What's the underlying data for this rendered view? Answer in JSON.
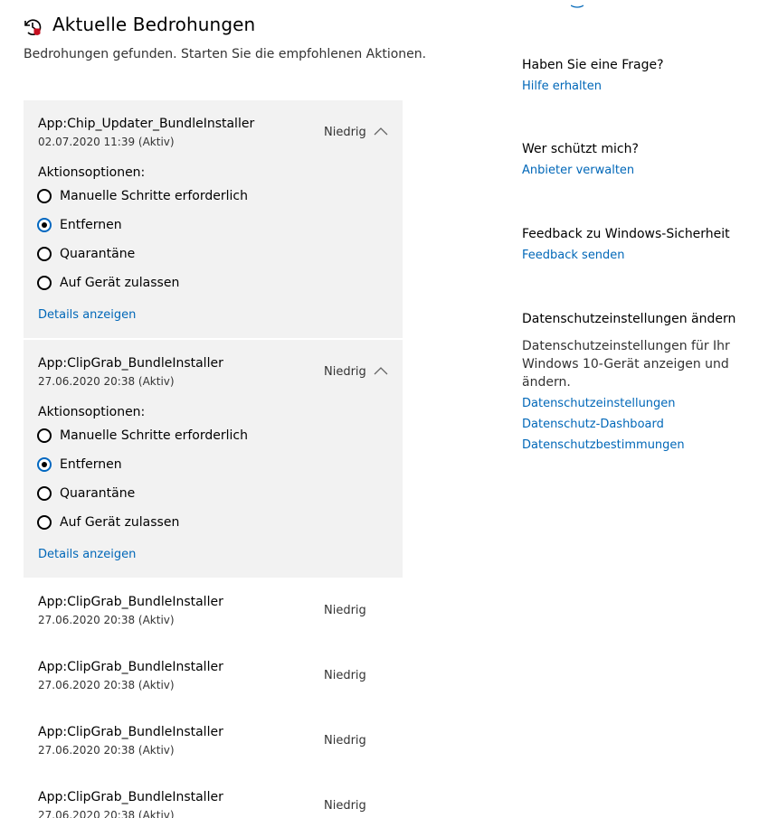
{
  "header": {
    "title": "Aktuelle Bedrohungen",
    "subtitle": "Bedrohungen gefunden. Starten Sie die empfohlenen Aktionen.",
    "icon": "history-shield-icon"
  },
  "threats": [
    {
      "name": "App:Chip_Updater_BundleInstaller",
      "date": "02.07.2020 11:39 (Aktiv)",
      "severity": "Niedrig",
      "expanded": true,
      "options_label": "Aktionsoptionen:",
      "options": [
        "Manuelle Schritte erforderlich",
        "Entfernen",
        "Quarantäne",
        "Auf Gerät zulassen"
      ],
      "selected": "Entfernen",
      "details_link": "Details anzeigen"
    },
    {
      "name": "App:ClipGrab_BundleInstaller",
      "date": "27.06.2020 20:38 (Aktiv)",
      "severity": "Niedrig",
      "expanded": true,
      "options_label": "Aktionsoptionen:",
      "options": [
        "Manuelle Schritte erforderlich",
        "Entfernen",
        "Quarantäne",
        "Auf Gerät zulassen"
      ],
      "selected": "Entfernen",
      "details_link": "Details anzeigen"
    },
    {
      "name": "App:ClipGrab_BundleInstaller",
      "date": "27.06.2020 20:38 (Aktiv)",
      "severity": "Niedrig",
      "expanded": false
    },
    {
      "name": "App:ClipGrab_BundleInstaller",
      "date": "27.06.2020 20:38 (Aktiv)",
      "severity": "Niedrig",
      "expanded": false
    },
    {
      "name": "App:ClipGrab_BundleInstaller",
      "date": "27.06.2020 20:38 (Aktiv)",
      "severity": "Niedrig",
      "expanded": false
    },
    {
      "name": "App:ClipGrab_BundleInstaller",
      "date": "27.06.2020 20:38 (Aktiv)",
      "severity": "Niedrig",
      "expanded": false
    }
  ],
  "sidebar": {
    "question": {
      "heading": "Haben Sie eine Frage?",
      "link": "Hilfe erhalten"
    },
    "protector": {
      "heading": "Wer schützt mich?",
      "link": "Anbieter verwalten"
    },
    "feedback": {
      "heading": "Feedback zu Windows-Sicherheit",
      "link": "Feedback senden"
    },
    "privacy": {
      "heading": "Datenschutzeinstellungen ändern",
      "text": "Datenschutzeinstellungen für Ihr Windows 10-Gerät anzeigen und ändern.",
      "links": [
        "Datenschutzeinstellungen",
        "Datenschutz-Dashboard",
        "Datenschutzbestimmungen"
      ]
    }
  },
  "colors": {
    "accent": "#0067b8",
    "expanded_bg": "#f2f2f2",
    "alert": "#c50f1f"
  }
}
